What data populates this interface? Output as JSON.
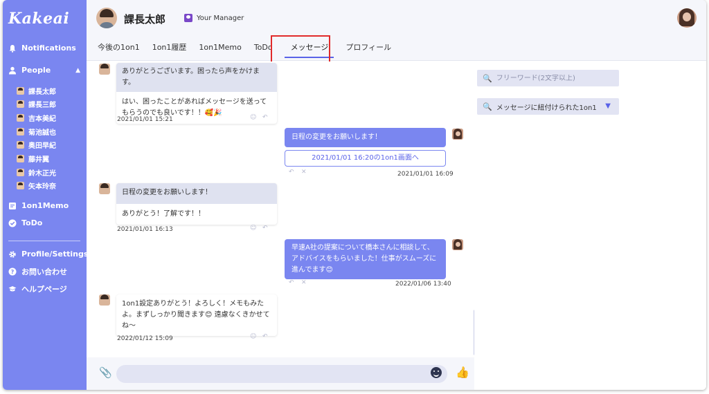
{
  "brand": "Kakeai",
  "sidebar": {
    "notifications": "Notifications",
    "people": "People",
    "people_members": [
      "課長太郎",
      "課長三郎",
      "吉本美紀",
      "菊池誠也",
      "奥田早紀",
      "藤井翼",
      "鈴木正光",
      "矢本玲奈"
    ],
    "memo": "1on1Memo",
    "todo": "ToDo",
    "profile": "Profile/Settings",
    "contact": "お問い合わせ",
    "help": "ヘルプページ"
  },
  "header": {
    "user_name": "課長太郎",
    "manager_badge": "Your Manager",
    "tabs": [
      "今後の1on1",
      "1on1履歴",
      "1on1Memo",
      "ToDo",
      "メッセージ",
      "プロフィール"
    ],
    "active_tab_index": 4
  },
  "messages": [
    {
      "side": "in",
      "quote": "ありがとうございます。困ったら声をかけます。",
      "text": "はい、困ったことがあればメッセージを送ってもらうのでも良いです！！🥰🎉",
      "time": "2021/01/01 15:21"
    },
    {
      "side": "out",
      "text": "日程の変更をお願いします！",
      "link": "2021/01/01 16:20の1on1画面へ",
      "time": "2021/01/01 16:09"
    },
    {
      "side": "in",
      "quote": "日程の変更をお願いします！",
      "text": "ありがとう！了解です！！",
      "time": "2021/01/01 16:13"
    },
    {
      "side": "out",
      "text": "早速A社の提案について橋本さんに相談して、アドバイスをもらいました！仕事がスムーズに進んでます😊",
      "time": "2022/01/06 13:40"
    },
    {
      "side": "in",
      "text": "1on1設定ありがとう！よろしく！メモもみたよ。まずしっかり聞きます😊 遠慮なくきかせてね〜",
      "time": "2022/01/12 15:09"
    }
  ],
  "input": {
    "placeholder": ""
  },
  "right_panel": {
    "search_placeholder": "フリーワード(2文字以上)",
    "filter_label": "メッセージに紐付けられた1on1"
  },
  "colors": {
    "sidebar": "#7a86f0",
    "accent": "#5962e8",
    "highlight": "#e12a2a"
  }
}
